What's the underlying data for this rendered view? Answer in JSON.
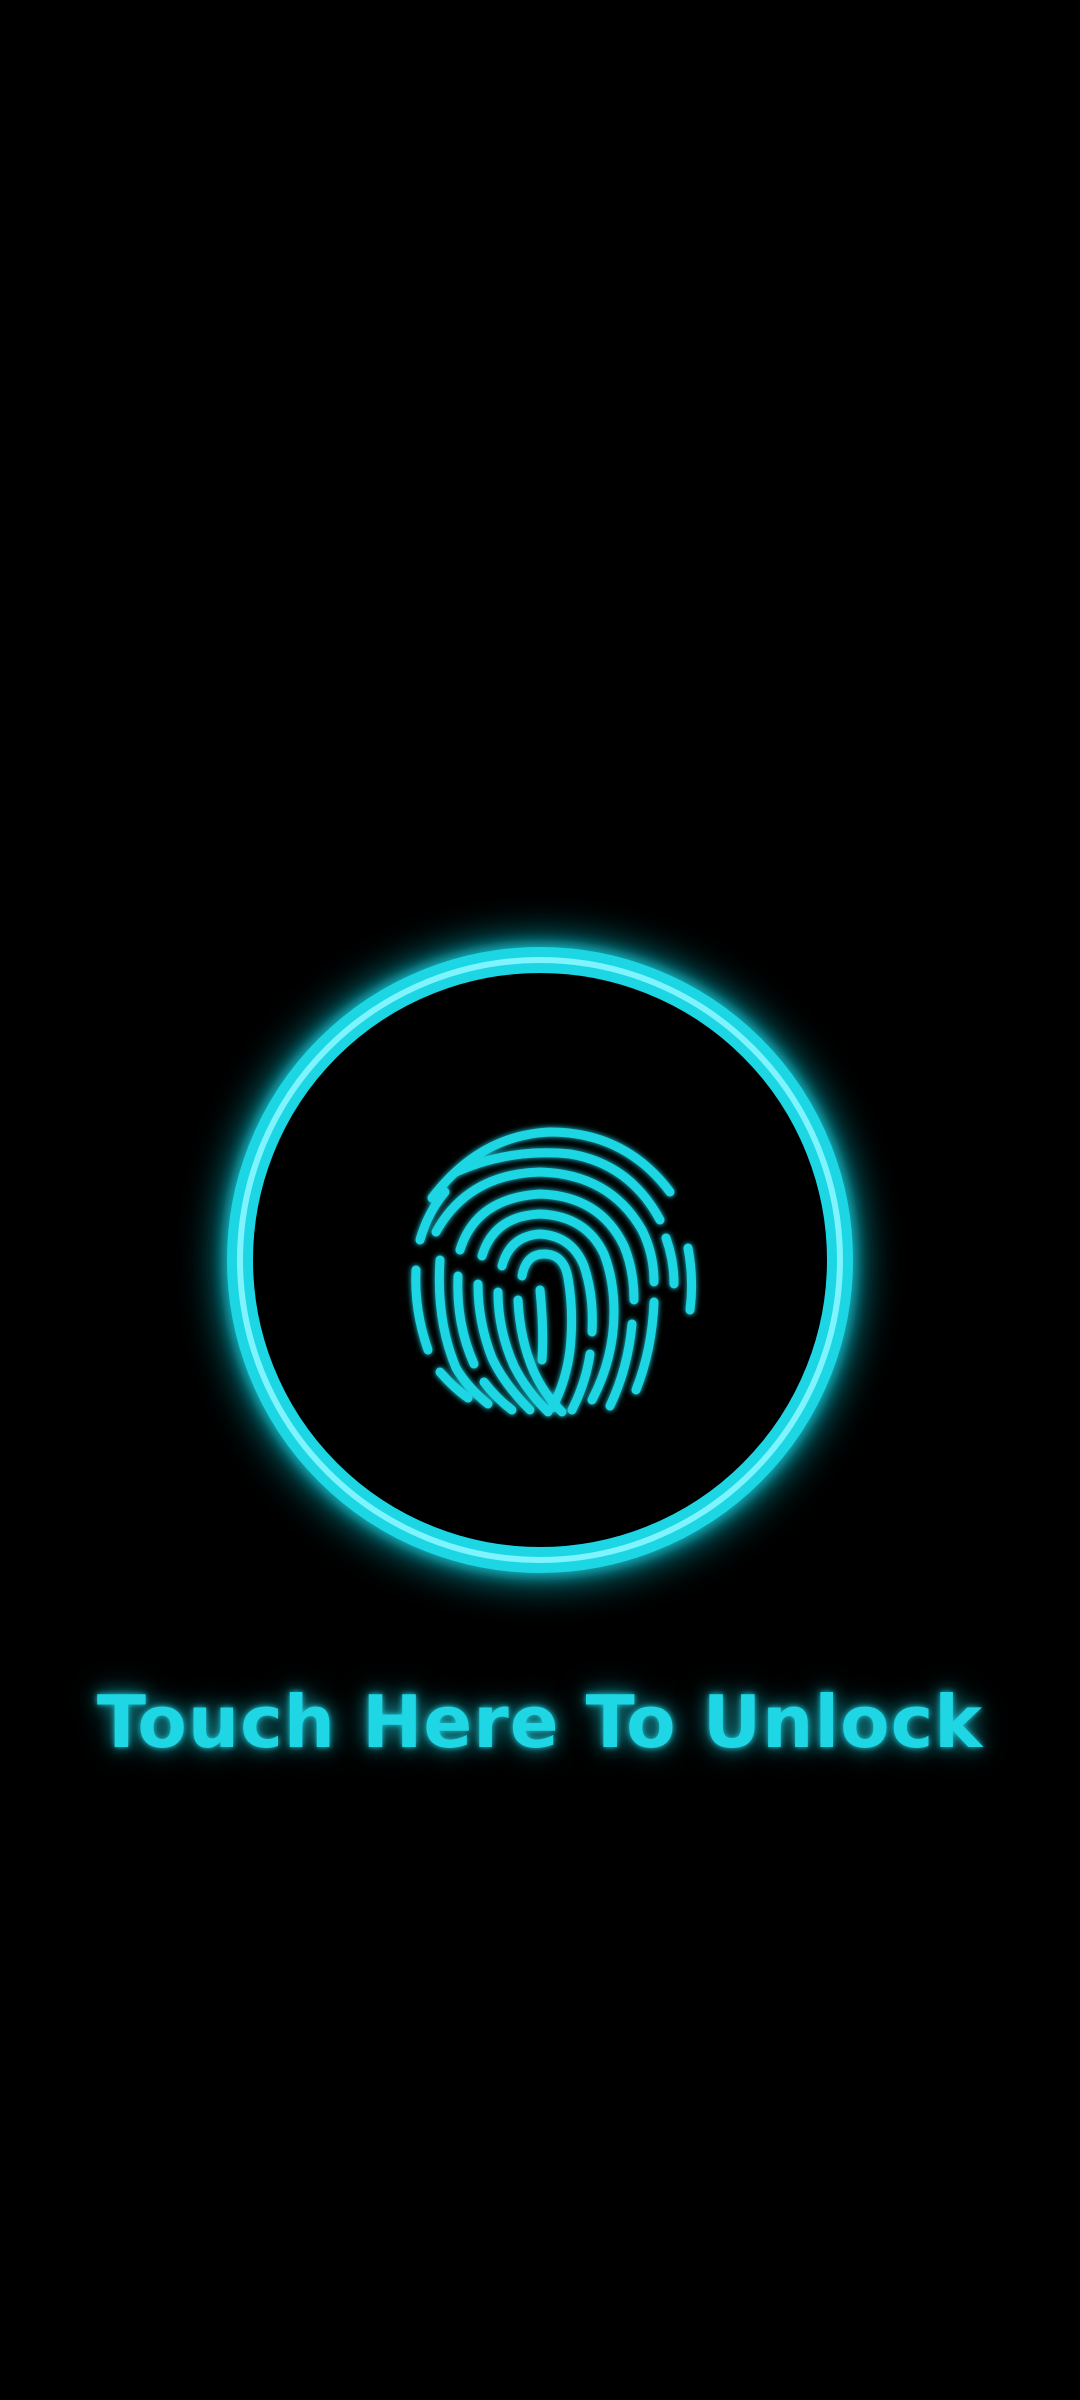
{
  "lock_screen": {
    "unlock_prompt": "Touch Here To Unlock",
    "sensor_icon": "fingerprint-icon",
    "accent_color": "#1fd6e4",
    "glow_color": "#16e0f0",
    "background_color": "#000000"
  }
}
